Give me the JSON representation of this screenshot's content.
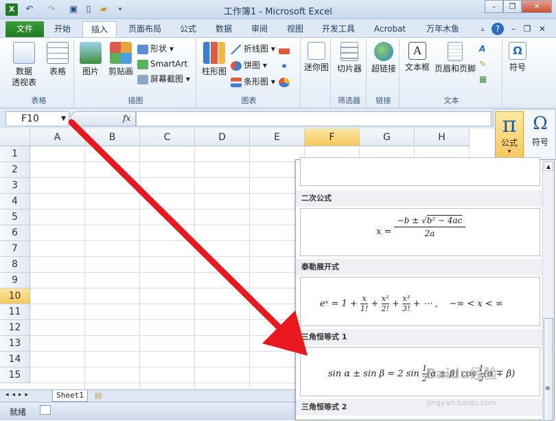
{
  "window": {
    "title": "工作簿1 - Microsoft Excel"
  },
  "tabs": [
    "文件",
    "开始",
    "插入",
    "页面布局",
    "公式",
    "数据",
    "审阅",
    "视图",
    "开发工具",
    "Acrobat",
    "万年木鱼"
  ],
  "ribbon": {
    "groups": [
      {
        "label": "表格",
        "buttons": [
          "数据\n透视表",
          "表格"
        ]
      },
      {
        "label": "插图",
        "buttons": [
          "图片",
          "剪贴画",
          "形状",
          "SmartArt",
          "屏幕截图"
        ]
      },
      {
        "label": "图表",
        "buttons": [
          "柱形图",
          "折线图",
          "饼图",
          "条形图"
        ]
      },
      {
        "label": "迷你图",
        "buttons": [
          "迷你图"
        ]
      },
      {
        "label": "筛选器",
        "buttons": [
          "切片器"
        ]
      },
      {
        "label": "链接",
        "buttons": [
          "超链接"
        ]
      },
      {
        "label": "文本",
        "buttons": [
          "文本框",
          "页眉和页脚"
        ]
      },
      {
        "label": "",
        "buttons": [
          "符号"
        ]
      }
    ]
  },
  "formula_bar": {
    "name_box": "F10",
    "fx": "fx",
    "value": ""
  },
  "grid": {
    "columns": [
      "A",
      "B",
      "C",
      "D",
      "E",
      "F",
      "G",
      "H"
    ],
    "rows": [
      "1",
      "2",
      "3",
      "4",
      "5",
      "6",
      "7",
      "8",
      "9",
      "10",
      "11",
      "12",
      "13",
      "14",
      "15"
    ],
    "selected_column": "F",
    "selected_row": "10"
  },
  "sheet_tabs": [
    "Sheet1"
  ],
  "status": "就绪",
  "equation_buttons": {
    "pi_label": "公式",
    "omega_label": "符号"
  },
  "equation_gallery": [
    {
      "header": "二次公式",
      "formula": "x = (−b ± √(b² − 4ac)) / 2a"
    },
    {
      "header": "泰勒展开式",
      "formula": "eˣ = 1 + x/1! + x²/2! + x³/3! + ⋯ ,   −∞ < x < ∞"
    },
    {
      "header": "三角恒等式 1",
      "formula": "sin α ± sin β = 2 sin ½(α ± β) cos ½(α ∓ β)"
    },
    {
      "header": "三角恒等式 2",
      "formula": ""
    }
  ],
  "watermark": "Baidu经验",
  "watermark_url": "jingyan.baidu.com",
  "colors": {
    "file_tab": "#2b8a2b",
    "selection": "#f5c85e",
    "arrow": "#e8181e"
  }
}
